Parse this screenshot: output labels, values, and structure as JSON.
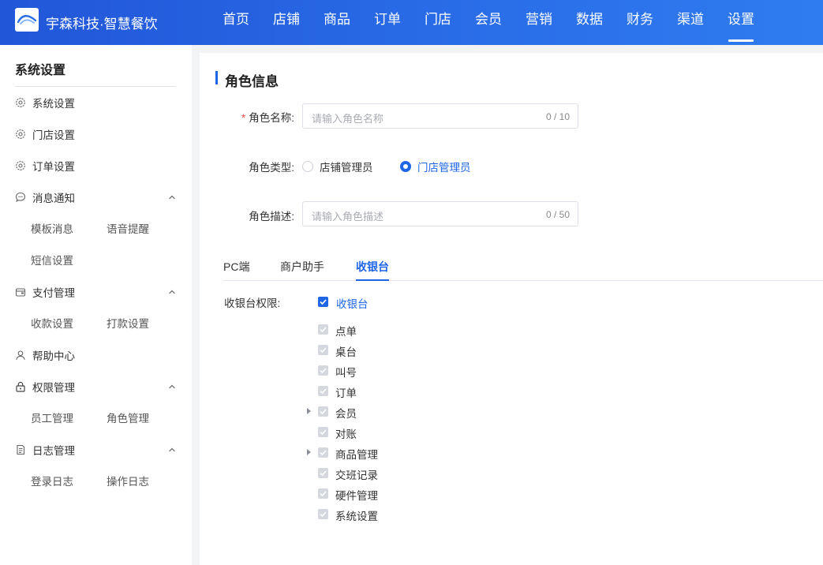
{
  "brand": "宇森科技·智慧餐饮",
  "nav": [
    "首页",
    "店铺",
    "商品",
    "订单",
    "门店",
    "会员",
    "营销",
    "数据",
    "财务",
    "渠道",
    "设置"
  ],
  "nav_active": "设置",
  "sidebar": {
    "title": "系统设置",
    "items": [
      {
        "label": "系统设置",
        "icon": "gear-icon"
      },
      {
        "label": "门店设置",
        "icon": "gear-icon"
      },
      {
        "label": "订单设置",
        "icon": "gear-icon"
      },
      {
        "label": "消息通知",
        "icon": "chat-bubble-icon",
        "expanded": true,
        "children": [
          "模板消息",
          "语音提醒",
          "短信设置"
        ]
      },
      {
        "label": "支付管理",
        "icon": "wallet-icon",
        "expanded": true,
        "children": [
          "收款设置",
          "打款设置"
        ]
      },
      {
        "label": "帮助中心",
        "icon": "user-icon"
      },
      {
        "label": "权限管理",
        "icon": "lock-icon",
        "expanded": true,
        "children": [
          "员工管理",
          "角色管理"
        ]
      },
      {
        "label": "日志管理",
        "icon": "document-icon",
        "expanded": true,
        "children": [
          "登录日志",
          "操作日志"
        ]
      }
    ]
  },
  "form": {
    "section_title": "角色信息",
    "name_label": "角色名称:",
    "name_required_mark": "*",
    "name_placeholder": "请输入角色名称",
    "name_counter": "0 / 10",
    "type_label": "角色类型:",
    "type_options": [
      "店铺管理员",
      "门店管理员"
    ],
    "type_selected": "门店管理员",
    "desc_label": "角色描述:",
    "desc_placeholder": "请输入角色描述",
    "desc_counter": "0 / 50"
  },
  "tabs": [
    "PC端",
    "商户助手",
    "收银台"
  ],
  "tab_active": "收银台",
  "permissions": {
    "label": "收银台权限:",
    "root": {
      "label": "收银台",
      "checked": true
    },
    "items": [
      {
        "label": "点单",
        "checked": true,
        "disabled": true,
        "expandable": false
      },
      {
        "label": "桌台",
        "checked": true,
        "disabled": true,
        "expandable": false
      },
      {
        "label": "叫号",
        "checked": true,
        "disabled": true,
        "expandable": false
      },
      {
        "label": "订单",
        "checked": true,
        "disabled": true,
        "expandable": false
      },
      {
        "label": "会员",
        "checked": true,
        "disabled": true,
        "expandable": true
      },
      {
        "label": "对账",
        "checked": true,
        "disabled": true,
        "expandable": false
      },
      {
        "label": "商品管理",
        "checked": true,
        "disabled": true,
        "expandable": true
      },
      {
        "label": "交班记录",
        "checked": true,
        "disabled": true,
        "expandable": false
      },
      {
        "label": "硬件管理",
        "checked": true,
        "disabled": true,
        "expandable": false
      },
      {
        "label": "系统设置",
        "checked": true,
        "disabled": true,
        "expandable": false
      }
    ]
  },
  "colors": {
    "primary": "#1f66e5",
    "topbar": "#2a6ee8",
    "required": "#e34d4d"
  }
}
